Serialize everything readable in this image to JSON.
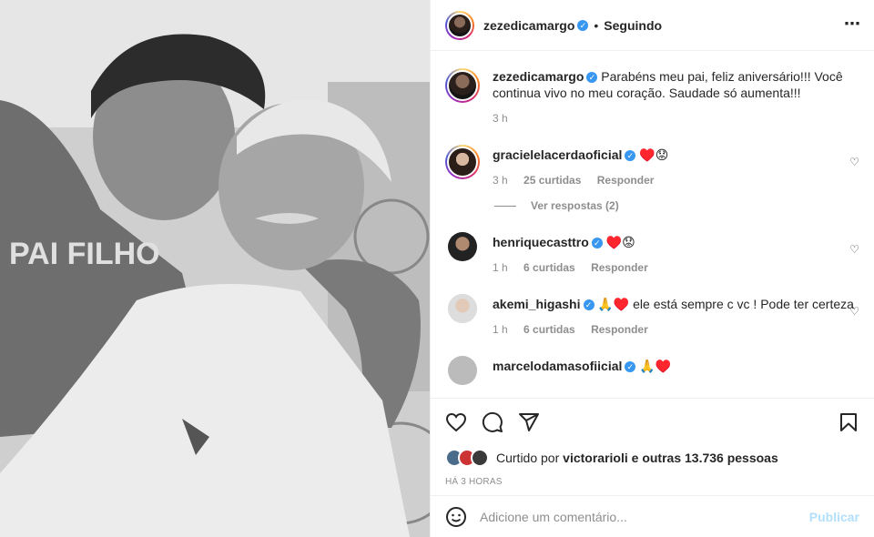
{
  "post": {
    "author": "zezedicamargo",
    "follow_status": "Seguindo",
    "separator": "•",
    "more_icon": "⋯",
    "caption_author": "zezedicamargo",
    "caption": "Parabéns meu pai, feliz aniversário!!! Você continua vivo no meu coração. Saudade só aumenta!!!",
    "caption_time": "3 h"
  },
  "comments": [
    {
      "user": "gracielelacerdaoficial",
      "text": "♥️😟",
      "time": "3 h",
      "likes": "25 curtidas",
      "reply": "Responder",
      "view_replies": "Ver respostas (2)"
    },
    {
      "user": "henriquecasttro",
      "text": "♥️😟",
      "time": "1 h",
      "likes": "6 curtidas",
      "reply": "Responder"
    },
    {
      "user": "akemi_higashi",
      "text": "🙏♥️ ele está sempre c vc ! Pode ter certeza",
      "time": "1 h",
      "likes": "6 curtidas",
      "reply": "Responder"
    },
    {
      "user": "marcelodamasofiicial",
      "text": "🙏♥️"
    }
  ],
  "likes": {
    "prefix": "Curtido por",
    "first_user": "victorarioli",
    "suffix": "e outras 13.736 pessoas"
  },
  "posted_ago": "HÁ 3 HORAS",
  "add_comment": {
    "placeholder": "Adicione um comentário...",
    "publish": "Publicar"
  },
  "colors": {
    "verified": "#3897f0",
    "publish": "#b2dffc",
    "muted": "#8e8e8e"
  },
  "icons": [
    "more-icon",
    "heart-icon",
    "comment-icon",
    "share-icon",
    "bookmark-icon",
    "emoji-icon",
    "verified-icon"
  ]
}
